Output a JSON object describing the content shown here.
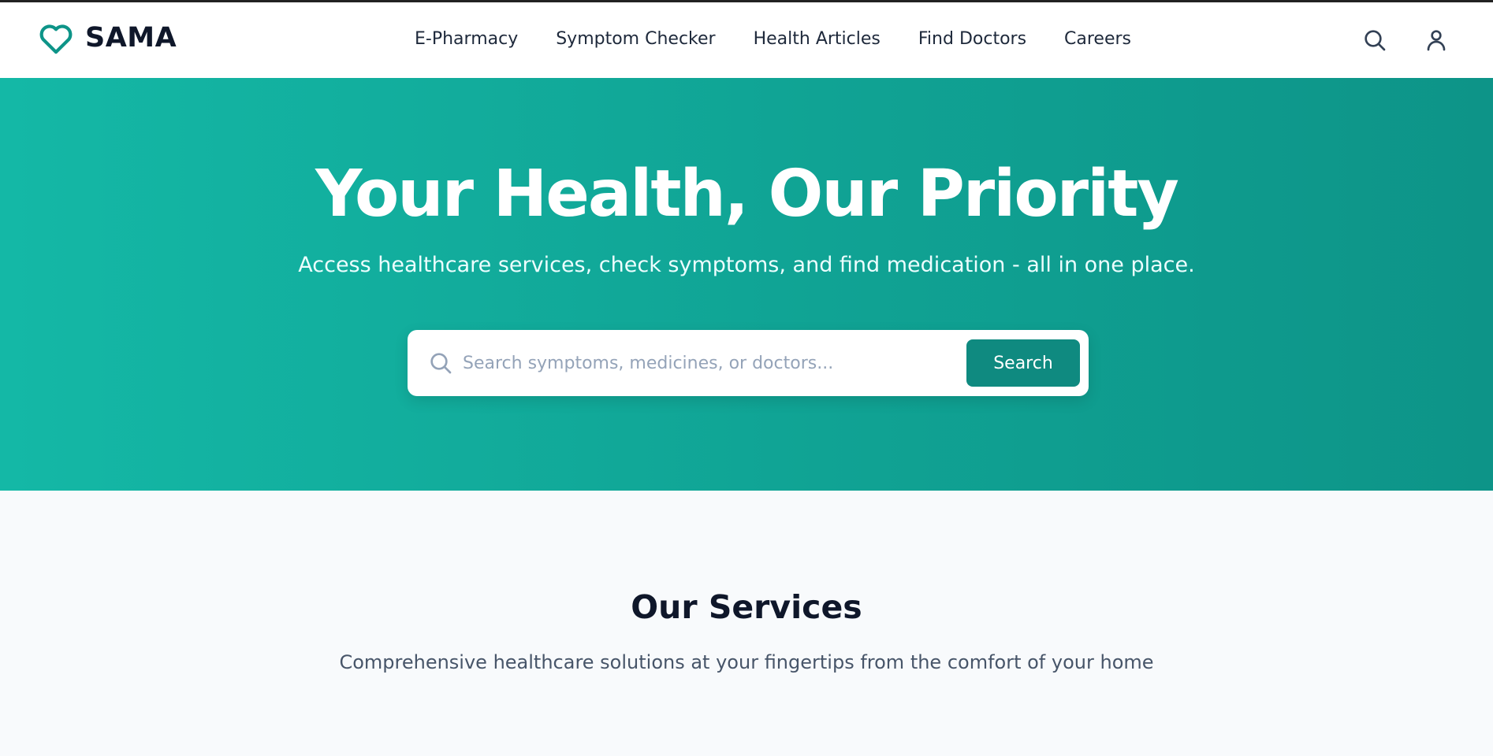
{
  "header": {
    "logo_text": "SAMA",
    "logo_icon": "heart-icon",
    "nav": [
      {
        "label": "E-Pharmacy"
      },
      {
        "label": "Symptom Checker"
      },
      {
        "label": "Health Articles"
      },
      {
        "label": "Find Doctors"
      },
      {
        "label": "Careers"
      }
    ],
    "icons": [
      "search-icon",
      "user-icon"
    ]
  },
  "hero": {
    "title": "Your Health, Our Priority",
    "subtitle": "Access healthcare services, check symptoms, and find medication - all in one place.",
    "search": {
      "placeholder": "Search symptoms, medicines, or doctors...",
      "value": "",
      "button_label": "Search",
      "icon": "search-icon"
    }
  },
  "services": {
    "title": "Our Services",
    "subtitle": "Comprehensive healthcare solutions at your fingertips from the comfort of your home"
  },
  "colors": {
    "accent": "#0d9488",
    "hero_gradient_start": "#14b8a6",
    "hero_gradient_end": "#0d9488",
    "button": "#0f8a80",
    "text_dark": "#0f172a",
    "section_bg": "#f8fafc"
  }
}
